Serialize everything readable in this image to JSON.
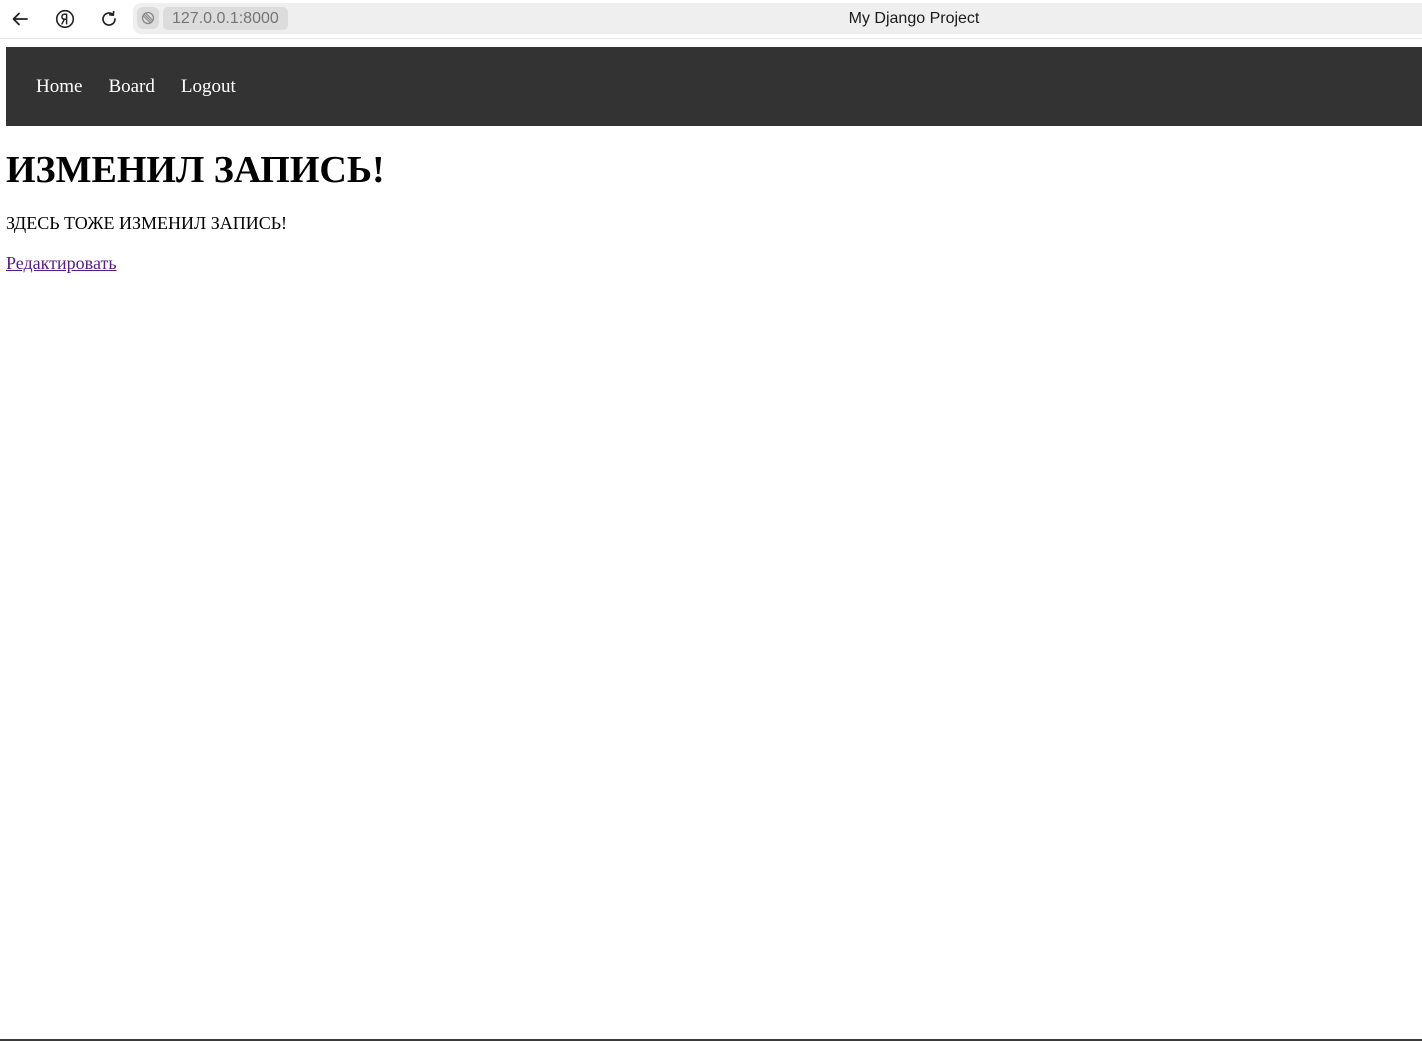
{
  "browser": {
    "url": "127.0.0.1:8000",
    "tab_title": "My Django Project",
    "back_icon": "arrow-left-icon",
    "yandex_icon": "yandex-logo-icon",
    "reload_icon": "reload-icon",
    "site_info_icon": "site-info-icon"
  },
  "nav": {
    "background": "#333333",
    "items": [
      {
        "label": "Home"
      },
      {
        "label": "Board"
      },
      {
        "label": "Logout"
      }
    ]
  },
  "post": {
    "title": "ИЗМЕНИЛ ЗАПИСЬ!",
    "text": "ЗДЕСЬ ТОЖЕ ИЗМЕНИЛ ЗАПИСЬ!",
    "edit_label": "Редактировать",
    "link_color": "#551a8b"
  }
}
